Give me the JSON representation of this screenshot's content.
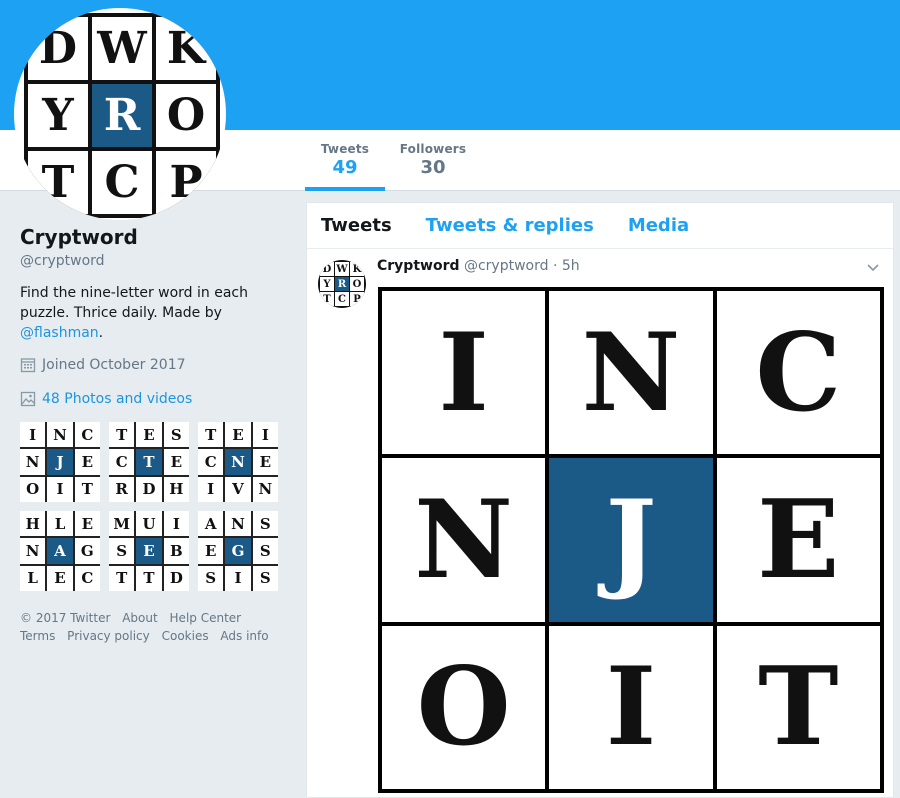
{
  "profile": {
    "name": "Cryptword",
    "handle": "@cryptword",
    "bio_text": "Find the nine-letter word in each puzzle. Thrice daily. Made by",
    "bio_link": "@flashman",
    "bio_end": ".",
    "joined": "Joined October 2017",
    "photos_link": "48 Photos and videos",
    "avatar_letters": [
      "D",
      "W",
      "K",
      "Y",
      "R",
      "O",
      "T",
      "C",
      "P"
    ]
  },
  "stats": {
    "tweets_label": "Tweets",
    "tweets_value": "49",
    "followers_label": "Followers",
    "followers_value": "30"
  },
  "thumbnails": [
    [
      "I",
      "N",
      "C",
      "N",
      "J",
      "E",
      "O",
      "I",
      "T"
    ],
    [
      "T",
      "E",
      "S",
      "C",
      "T",
      "E",
      "R",
      "D",
      "H"
    ],
    [
      "T",
      "E",
      "I",
      "C",
      "N",
      "E",
      "I",
      "V",
      "N"
    ],
    [
      "H",
      "L",
      "E",
      "N",
      "A",
      "G",
      "L",
      "E",
      "C"
    ],
    [
      "M",
      "U",
      "I",
      "S",
      "E",
      "B",
      "T",
      "T",
      "D"
    ],
    [
      "A",
      "N",
      "S",
      "E",
      "G",
      "S",
      "S",
      "I",
      "S"
    ]
  ],
  "footer": {
    "row1": [
      "© 2017 Twitter",
      "About",
      "Help Center"
    ],
    "row2": [
      "Terms",
      "Privacy policy",
      "Cookies",
      "Ads info"
    ]
  },
  "tabs": [
    "Tweets",
    "Tweets & replies",
    "Media"
  ],
  "tweet": {
    "name": "Cryptword",
    "handle": "@cryptword",
    "time": "· 5h",
    "grid": [
      "I",
      "N",
      "C",
      "N",
      "J",
      "E",
      "O",
      "I",
      "T"
    ],
    "avatar_letters": [
      "D",
      "W",
      "K",
      "Y",
      "R",
      "O",
      "T",
      "C",
      "P"
    ]
  },
  "colors": {
    "banner": "#1da1f2",
    "puzzle_center": "#1b5a87",
    "link": "#1b95e0"
  },
  "icons": [
    "calendar-icon",
    "photo-icon",
    "chevron-down-icon"
  ]
}
